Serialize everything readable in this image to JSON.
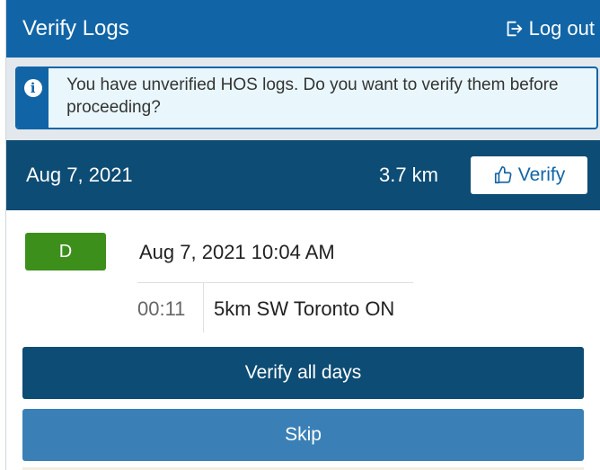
{
  "header": {
    "title": "Verify Logs",
    "logout_label": "Log out"
  },
  "banner": {
    "icon": "info-icon",
    "message": "You have unverified HOS logs. Do you want to verify them before proceeding?"
  },
  "day": {
    "date": "Aug 7, 2021",
    "distance": "3.7 km",
    "verify_label": "Verify"
  },
  "log_entry": {
    "status": "D",
    "time": "Aug 7, 2021 10:04 AM",
    "duration": "00:11",
    "location": "5km SW Toronto ON"
  },
  "actions": {
    "verify_all_label": "Verify all days",
    "skip_label": "Skip"
  },
  "colors": {
    "header": "#1165a6",
    "day_bar": "#0d4c74",
    "status_driving": "#3d8f1c",
    "skip_button": "#3a80b6"
  }
}
